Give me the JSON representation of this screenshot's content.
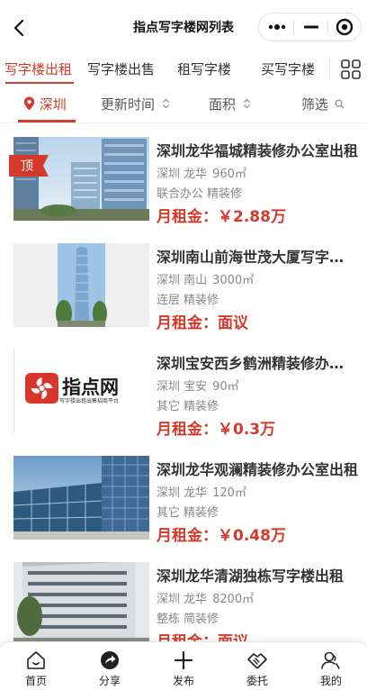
{
  "navbar": {
    "title": "指点写字楼网列表",
    "back_icon": "chevron-left-icon",
    "capsule_icons": [
      "more-dots-icon",
      "minimize-icon",
      "target-circle-icon"
    ]
  },
  "category_tabs": [
    {
      "label": "写字楼出租",
      "active": true
    },
    {
      "label": "写字楼出售",
      "active": false
    },
    {
      "label": "租写字楼",
      "active": false
    },
    {
      "label": "买写字楼",
      "active": false
    }
  ],
  "filters": {
    "city": "深圳",
    "update_time": "更新时间",
    "area": "面积",
    "filter": "筛选"
  },
  "listings": [
    {
      "title": "深圳龙华福城精装修办公室出租",
      "district": "深圳 龙华",
      "size": "960㎡",
      "tags": [
        "联合办公",
        "精装修"
      ],
      "price": "月租金：￥2.88万",
      "badge": "顶",
      "image": "glass-towers"
    },
    {
      "title": "深圳南山前海世茂大厦写字楼出租",
      "district": "深圳 南山",
      "size": "3000㎡",
      "tags": [
        "连层",
        "精装修"
      ],
      "price": "月租金：面议",
      "image": "tall-tower"
    },
    {
      "title": "深圳宝安西乡鹤洲精装修办公室出租",
      "district": "深圳 宝安",
      "size": "90㎡",
      "tags": [
        "其它",
        "精装修"
      ],
      "price": "月租金：￥0.3万",
      "image": "logo",
      "logo_text": "指点网",
      "logo_sub": "写字楼出租出售招商平台"
    },
    {
      "title": "深圳龙华观澜精装修办公室出租",
      "district": "深圳 龙华",
      "size": "120㎡",
      "tags": [
        "其它",
        "精装修"
      ],
      "price": "月租金：￥0.48万",
      "image": "glass-building"
    },
    {
      "title": "深圳龙华清湖独栋写字楼出租",
      "district": "深圳 龙华",
      "size": "8200㎡",
      "tags": [
        "整栋",
        "简装修"
      ],
      "price": "月租金：面议",
      "image": "white-building"
    }
  ],
  "tabbar": [
    {
      "label": "首页",
      "icon": "home-icon"
    },
    {
      "label": "分享",
      "icon": "share-icon"
    },
    {
      "label": "发布",
      "icon": "plus-icon"
    },
    {
      "label": "委托",
      "icon": "handshake-icon"
    },
    {
      "label": "我的",
      "icon": "user-icon"
    }
  ],
  "colors": {
    "accent": "#d43a2a",
    "text": "#333333",
    "muted": "#888888"
  }
}
